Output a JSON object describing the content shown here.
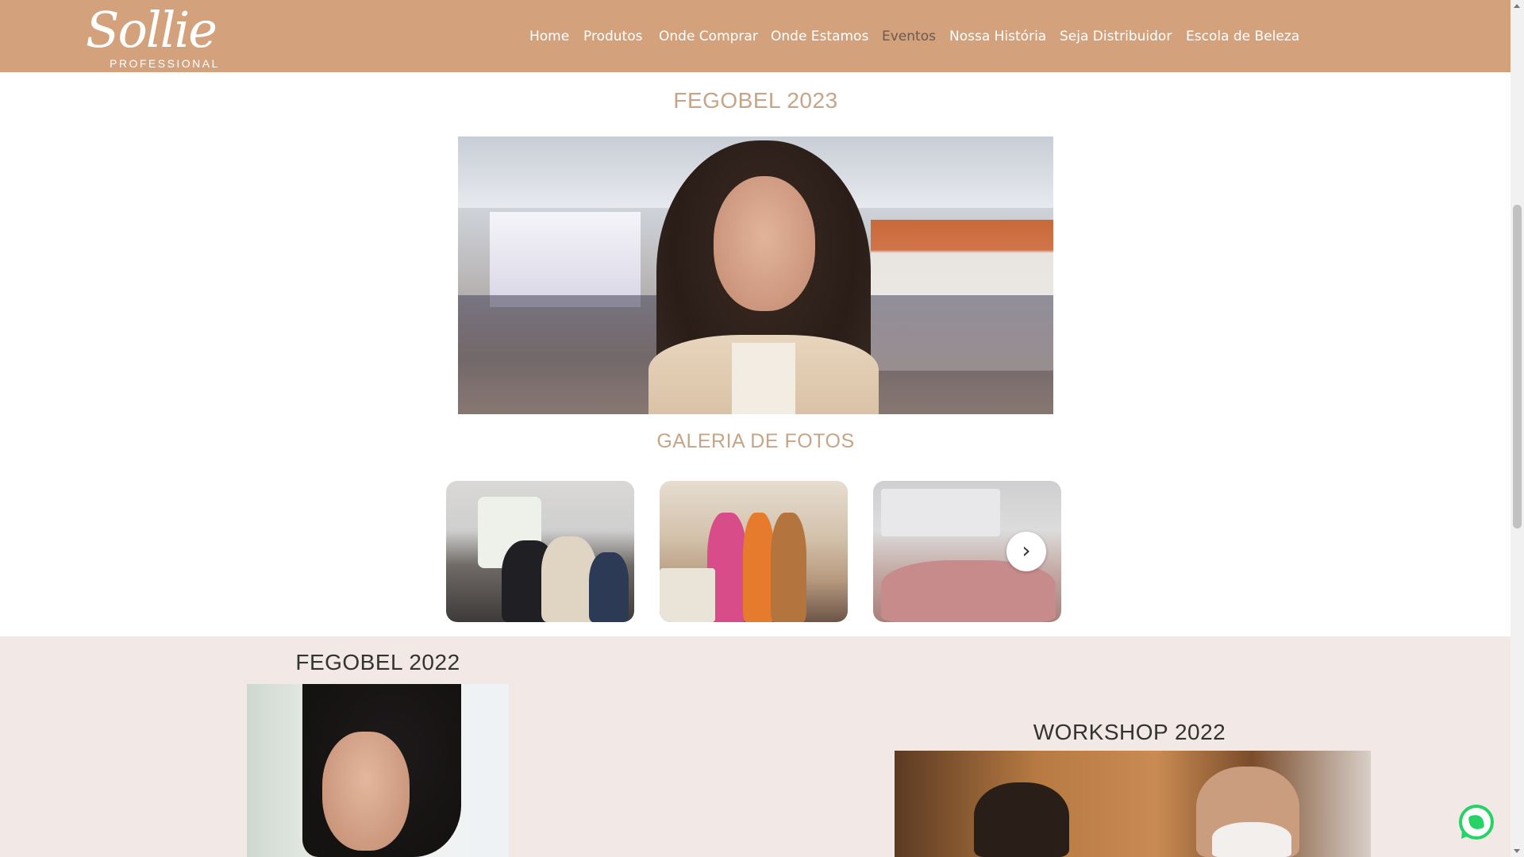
{
  "brand": {
    "logo_word": "Sollie",
    "logo_sub": "PROFESSIONAL"
  },
  "nav": {
    "items": [
      {
        "label": "Home"
      },
      {
        "label": "Produtos"
      },
      {
        "label": "Onde Comprar"
      },
      {
        "label": "Onde Estamos"
      },
      {
        "label": "Eventos",
        "active": true
      },
      {
        "label": "Nossa História"
      },
      {
        "label": "Seja Distribuidor"
      },
      {
        "label": "Escola de Beleza"
      }
    ]
  },
  "section_2023": {
    "title": "FEGOBEL 2023",
    "gallery_title": "GALERIA DE FOTOS",
    "next_icon": "chevron-right-icon"
  },
  "section_2022": {
    "fegobel_title": "FEGOBEL 2022",
    "workshop_title": "WORKSHOP 2022"
  },
  "colors": {
    "header": "#d3a27c",
    "accent_text": "#c8a486",
    "lower_bg": "#f2e9e6",
    "whatsapp": "#25d366"
  },
  "widgets": {
    "whatsapp_icon": "whatsapp-icon"
  }
}
